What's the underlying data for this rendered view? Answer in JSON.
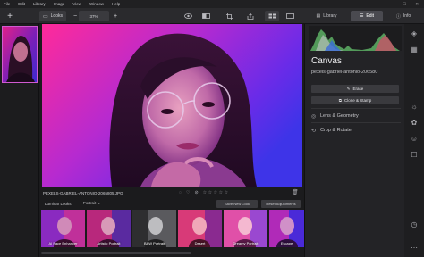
{
  "menu": [
    "File",
    "Edit",
    "Library",
    "Image",
    "View",
    "Window",
    "Help"
  ],
  "window_controls": [
    "—",
    "☐",
    "✕"
  ],
  "toolbar": {
    "add_label": "+",
    "looks_label": "Looks",
    "zoom_out": "−",
    "zoom_value": "37%",
    "zoom_in": "+"
  },
  "tabs": {
    "library": "Library",
    "edit": "Edit",
    "info": "Info"
  },
  "image": {
    "filename": "PEXELS-GABRIEL-ANTONIO-2065805.JPG",
    "stars": [
      "☆",
      "☆",
      "☆",
      "☆",
      "☆"
    ]
  },
  "looks_bar": {
    "label": "Luminar Looks:",
    "category": "Portrait",
    "save_label": "Save New Look",
    "reset_label": "Reset Adjustments"
  },
  "looks": [
    {
      "name": "AI Face Enhancer"
    },
    {
      "name": "Artistic Portrait"
    },
    {
      "name": "B&W Portrait"
    },
    {
      "name": "Desert"
    },
    {
      "name": "Dreamy Portrait"
    },
    {
      "name": "Escape"
    }
  ],
  "panel": {
    "title": "Canvas",
    "filename": "pexels-gabriel-antonio-206580",
    "erase_label": "Erase",
    "clone_label": "Clone & Stamp",
    "sections": [
      "Lens & Geometry",
      "Crop & Rotate"
    ]
  },
  "colors": {
    "accent": "#d05ad0",
    "panel": "#232326",
    "button": "#3a3a3e"
  }
}
